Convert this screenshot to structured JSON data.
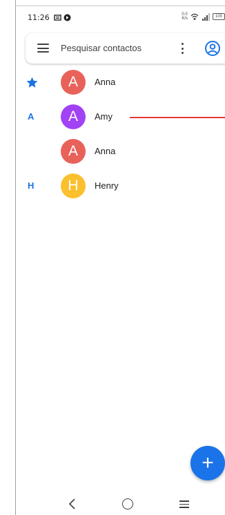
{
  "status_bar": {
    "time": "11:26",
    "left_icons": [
      "sim-icon",
      "notification-icon"
    ],
    "right_icons": [
      "data-speed-icon",
      "wifi-icon",
      "signal-icon",
      "battery-icon"
    ],
    "data_speed": "0.0\nK/s",
    "battery": "100"
  },
  "search": {
    "placeholder": "Pesquisar contactos",
    "menu_icon": "hamburger-menu-icon",
    "more_icon": "more-vert-icon",
    "account_icon": "account-circle-icon"
  },
  "contacts": [
    {
      "section": "star",
      "name": "Anna",
      "initial": "A",
      "color": "#e8625a"
    },
    {
      "section": "A",
      "name": "Amy",
      "initial": "A",
      "color": "#a142f4"
    },
    {
      "section": "",
      "name": "Anna",
      "initial": "A",
      "color": "#e8625a"
    },
    {
      "section": "H",
      "name": "Henry",
      "initial": "H",
      "color": "#fbc02d"
    }
  ],
  "fab": {
    "icon": "add-icon",
    "label": "+"
  },
  "nav_bar": {
    "back": "back-icon",
    "home": "home-icon",
    "recents": "recents-icon"
  },
  "colors": {
    "accent": "#1a73e8",
    "swipe_line": "#e53935"
  }
}
